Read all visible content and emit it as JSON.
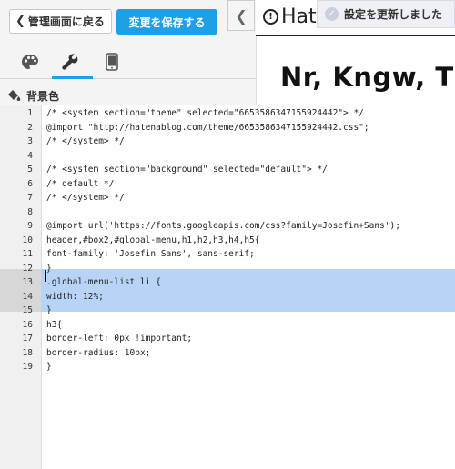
{
  "header": {
    "back_label": "管理画面に戻る",
    "back_icon": "chevron-left-icon",
    "save_label": "変更を保存する",
    "accent_color": "#1fa0e6"
  },
  "tabs": [
    {
      "name": "theme",
      "icon": "palette-icon"
    },
    {
      "name": "customize",
      "icon": "wrench-icon",
      "active": true
    },
    {
      "name": "mobile",
      "icon": "smartphone-icon"
    }
  ],
  "section": {
    "label": "背景色",
    "icon": "paint-bucket-icon"
  },
  "editor": {
    "highlighted_lines": [
      13,
      14,
      15
    ],
    "lines": [
      {
        "n": "1",
        "text": "/* <system section=\"theme\" selected=\"6653586347155924442\"> */"
      },
      {
        "n": "2",
        "text": "@import \"http://hatenablog.com/theme/6653586347155924442.css\";"
      },
      {
        "n": "3",
        "text": "/* </system> */"
      },
      {
        "n": "4",
        "text": ""
      },
      {
        "n": "5",
        "text": "/* <system section=\"background\" selected=\"default\"> */"
      },
      {
        "n": "6",
        "text": "/* default */"
      },
      {
        "n": "7",
        "text": "/* </system> */"
      },
      {
        "n": "8",
        "text": ""
      },
      {
        "n": "9",
        "text": "@import url('https://fonts.googleapis.com/css?family=Josefin+Sans');"
      },
      {
        "n": "10",
        "text": "header,#box2,#global-menu,h1,h2,h3,h4,h5{"
      },
      {
        "n": "11",
        "text": "font-family: 'Josefin Sans', sans-serif;"
      },
      {
        "n": "12",
        "text": "}"
      },
      {
        "n": "13",
        "text": ".global-menu-list li {"
      },
      {
        "n": "14",
        "text": "width: 12%;"
      },
      {
        "n": "15",
        "text": "}"
      },
      {
        "n": "16",
        "text": "h3{"
      },
      {
        "n": "17",
        "text": "border-left: 0px !important;"
      },
      {
        "n": "18",
        "text": "border-radius: 10px;"
      },
      {
        "n": "19",
        "text": "}"
      }
    ]
  },
  "preview": {
    "collapse_icon": "chevron-left-icon",
    "logo_text": "Hat",
    "toast_text": "設定を更新しました",
    "toast_icon": "check-icon",
    "blog_title": "Nr, Kngw, Tk"
  }
}
